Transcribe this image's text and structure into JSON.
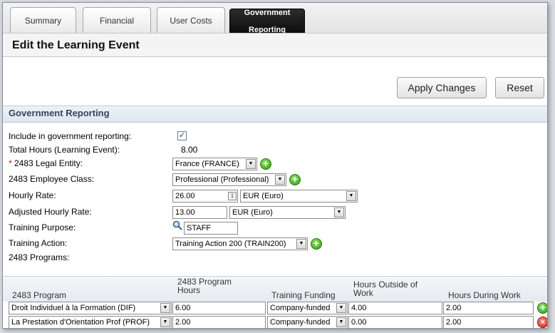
{
  "tabs": [
    {
      "label": "Summary"
    },
    {
      "label": "Financial"
    },
    {
      "label": "User Costs"
    },
    {
      "label_line1": "Government",
      "label_line2": "Reporting"
    }
  ],
  "page": {
    "title": "Edit the Learning Event"
  },
  "toolbar": {
    "apply_label": "Apply Changes",
    "reset_label": "Reset"
  },
  "section": {
    "title": "Government Reporting"
  },
  "form": {
    "include_label": "Include in government reporting:",
    "include_checked": "✓",
    "total_hours_label": "Total Hours (Learning Event):",
    "total_hours_value": "8.00",
    "required_mark": "*",
    "legal_entity_label": " 2483 Legal Entity:",
    "legal_entity_value": "France (FRANCE)",
    "employee_class_label": "2483 Employee Class:",
    "employee_class_value": "Professional (Professional)",
    "hourly_rate_label": "Hourly Rate:",
    "hourly_rate_value": "26.00",
    "hourly_rate_currency": "EUR (Euro)",
    "adjusted_rate_label": "Adjusted Hourly Rate:",
    "adjusted_rate_value": "13.00",
    "adjusted_rate_currency": "EUR (Euro)",
    "training_purpose_label": "Training Purpose:",
    "training_purpose_value": "STAFF",
    "training_action_label": "Training Action:",
    "training_action_value": "Training Action 200 (TRAIN200)",
    "programs_label": "2483 Programs:"
  },
  "table": {
    "headers": {
      "program": "2483 Program",
      "program_hours_1": "2483 Program",
      "program_hours_2": "Hours",
      "funding": "Training Funding",
      "outside_1": "Hours Outside of",
      "outside_2": "Work",
      "during": "Hours During Work"
    },
    "rows": [
      {
        "program": "Droit Individuel à la Formation (DIF)",
        "hours": "6.00",
        "funding": "Company-funded",
        "outside": "4.00",
        "during": "2.00"
      },
      {
        "program": "La Prestation d'Orientation Prof (PROF)",
        "hours": "2.00",
        "funding": "Company-funded",
        "outside": "0.00",
        "during": "2.00"
      }
    ]
  },
  "icons": {
    "add": "+",
    "remove": "×",
    "dropdown": "▼",
    "calendar": "1"
  },
  "colors": {
    "accent": "#33445e",
    "add": "#2f9a16",
    "remove": "#c4240f",
    "active_tab": "#111111"
  }
}
